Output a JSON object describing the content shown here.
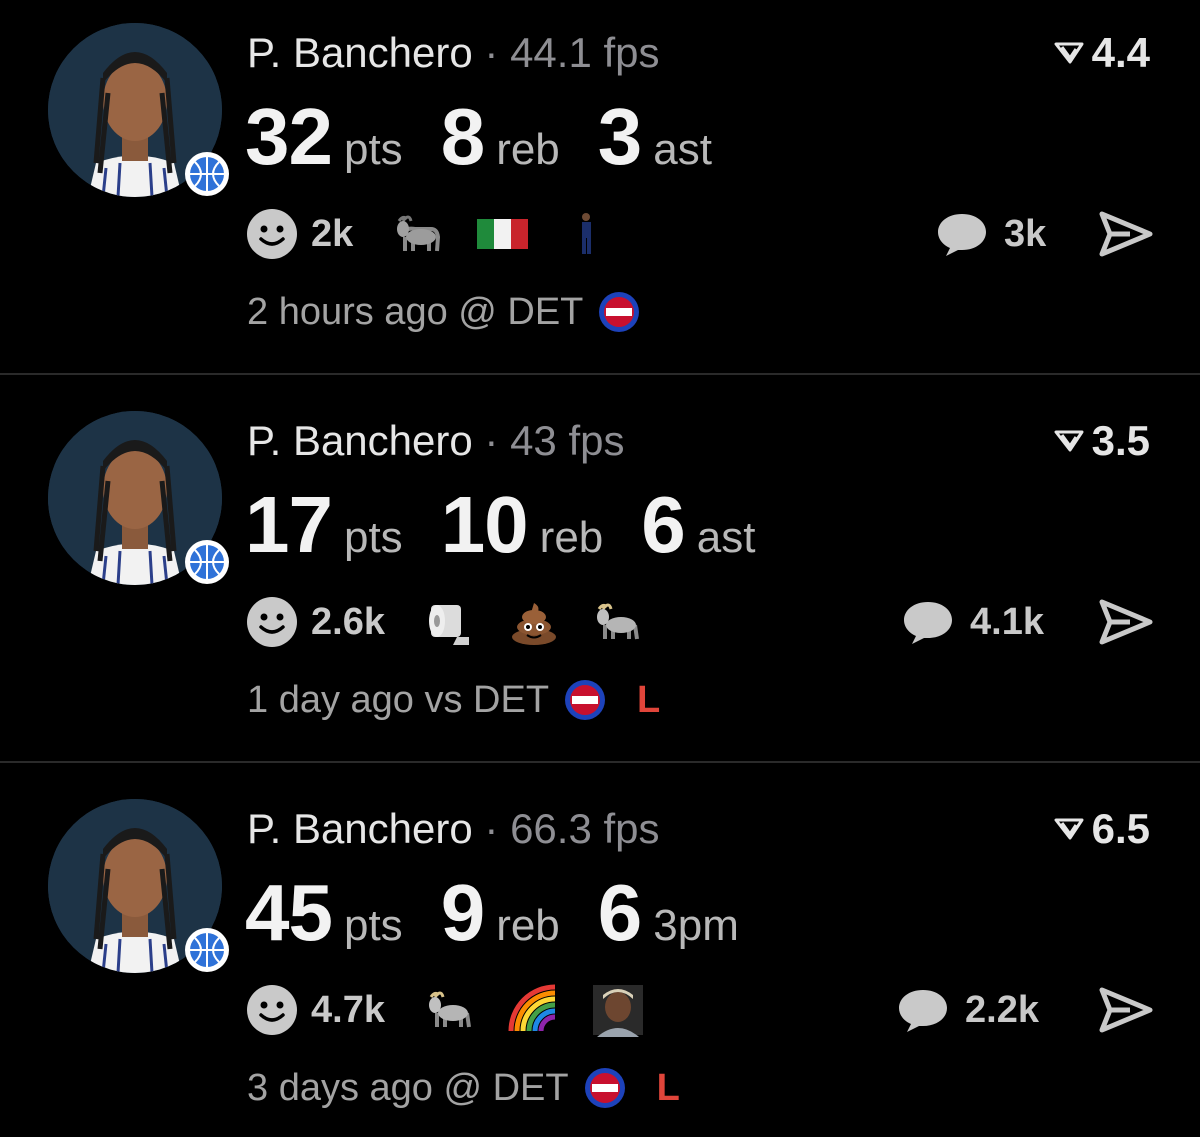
{
  "feed": [
    {
      "player_name": "P. Banchero",
      "separator": "·",
      "fps": "44.1 fps",
      "rating": "4.4",
      "stats": [
        {
          "value": "32",
          "unit": "pts"
        },
        {
          "value": "8",
          "unit": "reb"
        },
        {
          "value": "3",
          "unit": "ast"
        }
      ],
      "reaction_count": "2k",
      "emojis": [
        "goat-emoji",
        "italy-flag-emoji",
        "player-figure-emoji"
      ],
      "comment_count": "3k",
      "time": "2 hours ago @ DET",
      "result": ""
    },
    {
      "player_name": "P. Banchero",
      "separator": "·",
      "fps": "43 fps",
      "rating": "3.5",
      "stats": [
        {
          "value": "17",
          "unit": "pts"
        },
        {
          "value": "10",
          "unit": "reb"
        },
        {
          "value": "6",
          "unit": "ast"
        }
      ],
      "reaction_count": "2.6k",
      "emojis": [
        "toilet-paper-emoji",
        "poop-emoji",
        "goat-emoji"
      ],
      "comment_count": "4.1k",
      "time": "1 day ago vs DET",
      "result": "L"
    },
    {
      "player_name": "P. Banchero",
      "separator": "·",
      "fps": "66.3 fps",
      "rating": "6.5",
      "stats": [
        {
          "value": "45",
          "unit": "pts"
        },
        {
          "value": "9",
          "unit": "reb"
        },
        {
          "value": "6",
          "unit": "3pm"
        }
      ],
      "reaction_count": "4.7k",
      "emojis": [
        "goat-emoji",
        "rainbow-emoji",
        "person-photo-emoji"
      ],
      "comment_count": "2.2k",
      "time": "3 days ago @ DET",
      "result": "L"
    }
  ],
  "colors": {
    "background": "#000000",
    "muted_text": "#8e8e93",
    "loss": "#e0453a",
    "pistons_red": "#c8102e",
    "pistons_blue": "#1d42ba"
  }
}
